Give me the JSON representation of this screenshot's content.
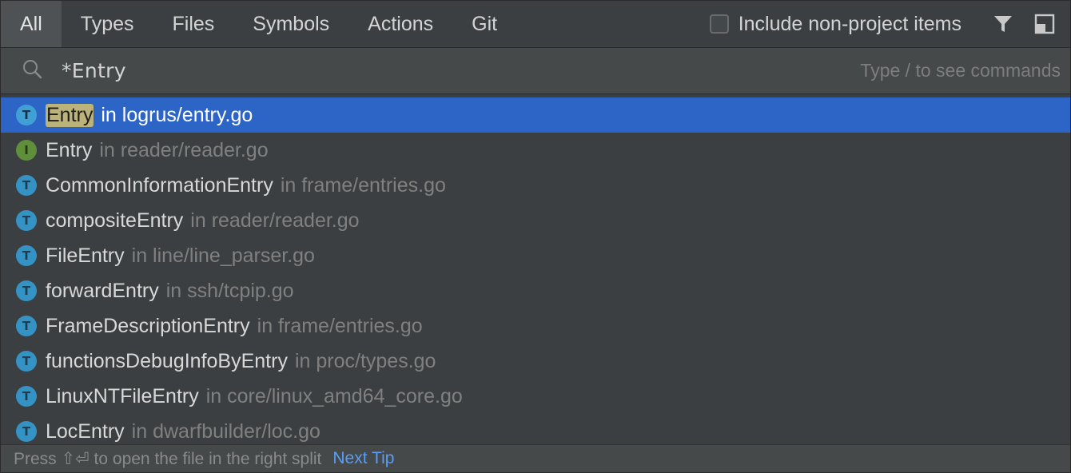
{
  "tabs": [
    {
      "label": "All",
      "active": true
    },
    {
      "label": "Types"
    },
    {
      "label": "Files"
    },
    {
      "label": "Symbols"
    },
    {
      "label": "Actions"
    },
    {
      "label": "Git"
    }
  ],
  "toolbar": {
    "include_non_project_label": "Include non-project items",
    "filter_icon": "filter-icon",
    "preview_icon": "preview-panel-icon"
  },
  "search": {
    "query": "*Entry",
    "hint": "Type / to see commands",
    "icon": "search-icon"
  },
  "results": [
    {
      "kind": "T",
      "name": "Entry",
      "location": "in logrus/entry.go",
      "selected": true
    },
    {
      "kind": "I",
      "name": "Entry",
      "location": "in reader/reader.go"
    },
    {
      "kind": "T",
      "name": "CommonInformationEntry",
      "location": "in frame/entries.go"
    },
    {
      "kind": "T",
      "name": "compositeEntry",
      "location": "in reader/reader.go"
    },
    {
      "kind": "T",
      "name": "FileEntry",
      "location": "in line/line_parser.go"
    },
    {
      "kind": "T",
      "name": "forwardEntry",
      "location": "in ssh/tcpip.go"
    },
    {
      "kind": "T",
      "name": "FrameDescriptionEntry",
      "location": "in frame/entries.go"
    },
    {
      "kind": "T",
      "name": "functionsDebugInfoByEntry",
      "location": "in proc/types.go"
    },
    {
      "kind": "T",
      "name": "LinuxNTFileEntry",
      "location": "in core/linux_amd64_core.go"
    },
    {
      "kind": "T",
      "name": "LocEntry",
      "location": "in dwarfbuilder/loc.go"
    }
  ],
  "footer": {
    "tip": "Press ⇧⏎ to open the file in the right split",
    "next_tip_label": "Next Tip"
  },
  "colors": {
    "selection": "#2d65c6",
    "type_badge": "#3592c4",
    "interface_badge": "#5f8f3a",
    "link": "#589df6"
  }
}
